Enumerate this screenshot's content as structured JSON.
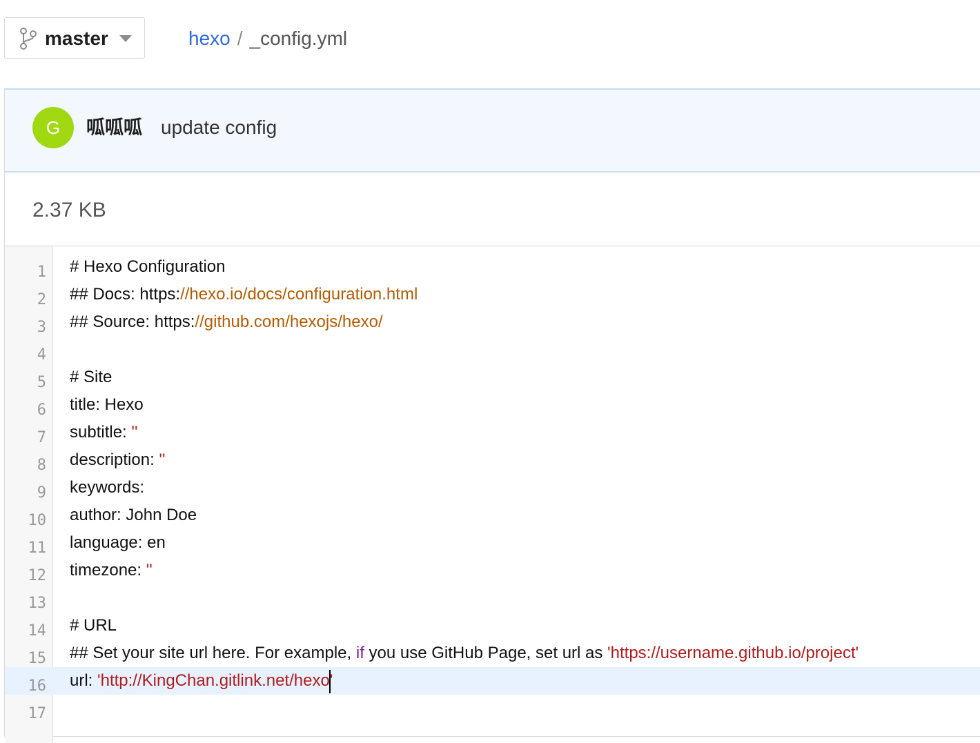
{
  "branch": {
    "name": "master"
  },
  "breadcrumb": {
    "repo": "hexo",
    "separator": "/",
    "file": "_config.yml"
  },
  "commit": {
    "avatar_letter": "G",
    "author": "呱呱呱",
    "message": "update config",
    "avatar_color": "#a0d911"
  },
  "file": {
    "size": "2.37 KB"
  },
  "editor": {
    "active_line": 16,
    "lines": [
      {
        "num": "1",
        "parts": [
          {
            "t": "# Hexo Configuration",
            "c": ""
          }
        ]
      },
      {
        "num": "2",
        "parts": [
          {
            "t": "## Docs: https:",
            "c": ""
          },
          {
            "t": "//hexo.io/docs/configuration.html",
            "c": "tok-url"
          }
        ]
      },
      {
        "num": "3",
        "parts": [
          {
            "t": "## Source: https:",
            "c": ""
          },
          {
            "t": "//github.com/hexojs/hexo/",
            "c": "tok-url"
          }
        ]
      },
      {
        "num": "4",
        "parts": []
      },
      {
        "num": "5",
        "parts": [
          {
            "t": "# Site",
            "c": ""
          }
        ]
      },
      {
        "num": "6",
        "parts": [
          {
            "t": "title: Hexo",
            "c": ""
          }
        ]
      },
      {
        "num": "7",
        "parts": [
          {
            "t": "subtitle: ",
            "c": ""
          },
          {
            "t": "''",
            "c": "tok-str"
          }
        ]
      },
      {
        "num": "8",
        "parts": [
          {
            "t": "description: ",
            "c": ""
          },
          {
            "t": "''",
            "c": "tok-str"
          }
        ]
      },
      {
        "num": "9",
        "parts": [
          {
            "t": "keywords:",
            "c": ""
          }
        ]
      },
      {
        "num": "10",
        "parts": [
          {
            "t": "author: John Doe",
            "c": ""
          }
        ]
      },
      {
        "num": "11",
        "parts": [
          {
            "t": "language: en",
            "c": ""
          }
        ]
      },
      {
        "num": "12",
        "parts": [
          {
            "t": "timezone: ",
            "c": ""
          },
          {
            "t": "''",
            "c": "tok-str"
          }
        ]
      },
      {
        "num": "13",
        "parts": []
      },
      {
        "num": "14",
        "parts": [
          {
            "t": "# URL",
            "c": ""
          }
        ]
      },
      {
        "num": "15",
        "parts": [
          {
            "t": "## Set your site url here. For example, ",
            "c": ""
          },
          {
            "t": "if",
            "c": "tok-kw"
          },
          {
            "t": " you use GitHub Page, set url as ",
            "c": ""
          },
          {
            "t": "'https://username.github.io/project'",
            "c": "tok-str"
          }
        ]
      },
      {
        "num": "16",
        "parts": [
          {
            "t": "url: ",
            "c": ""
          },
          {
            "t": "'http://KingChan.gitlink.net/hexo",
            "c": "tok-str"
          },
          {
            "t": "CARET",
            "c": "caret"
          },
          {
            "t": "'",
            "c": "tok-str"
          }
        ]
      },
      {
        "num": "17",
        "parts": []
      }
    ]
  },
  "colors": {
    "link": "#2d6be4",
    "url_token": "#b75b00",
    "string_token": "#b31b1b",
    "keyword_token": "#7a1fa2",
    "active_line_bg": "#e8f2ff"
  }
}
